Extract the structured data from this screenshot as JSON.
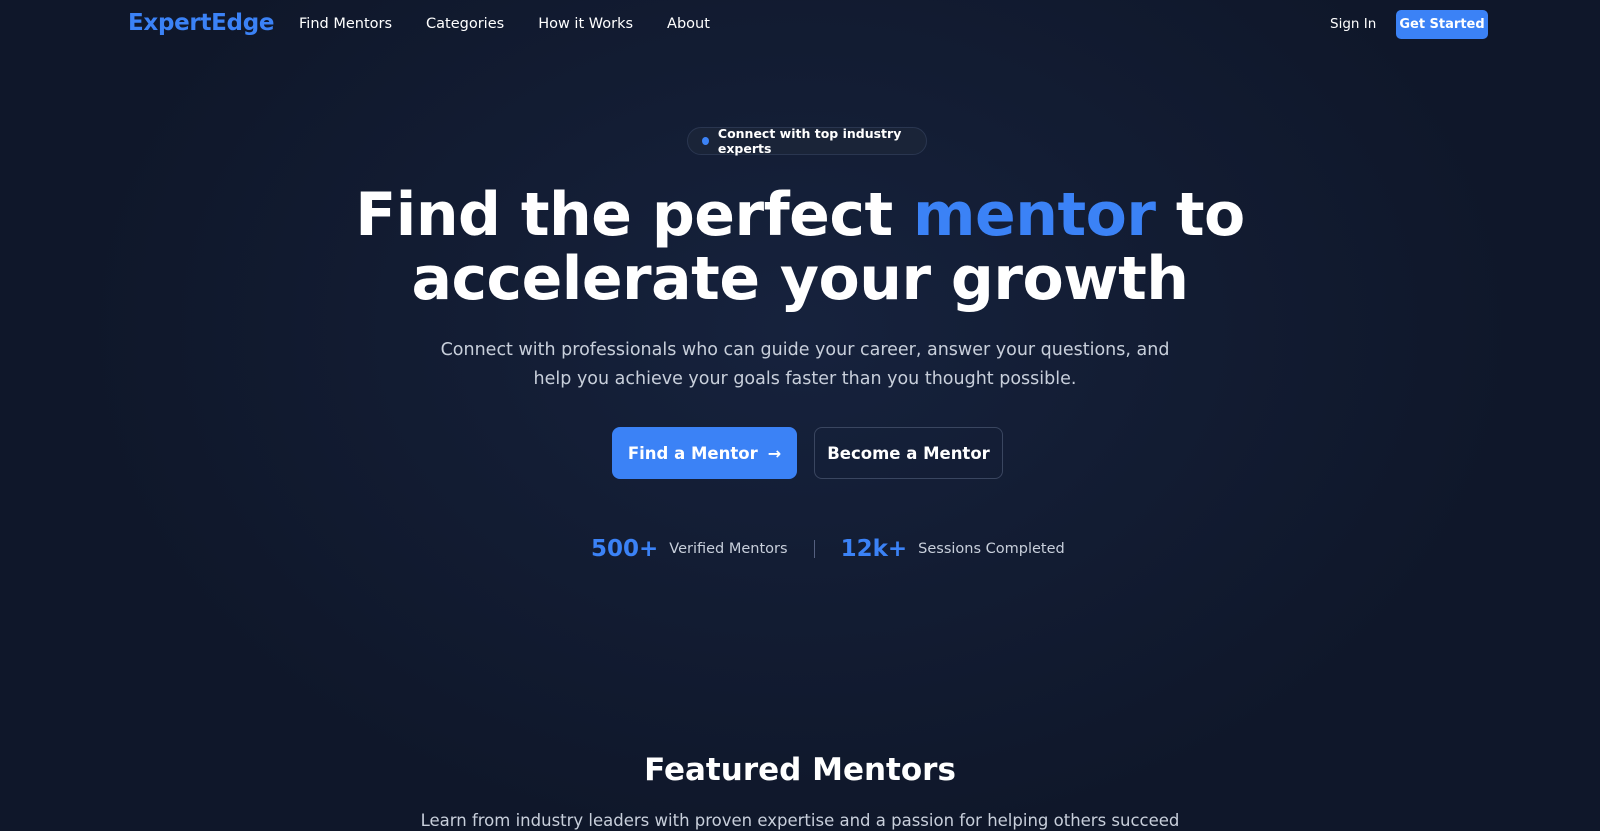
{
  "header": {
    "logo": "ExpertEdge",
    "nav": [
      "Find Mentors",
      "Categories",
      "How it Works",
      "About"
    ],
    "sign_in": "Sign In",
    "get_started": "Get Started"
  },
  "hero": {
    "badge": "Connect with top industry experts",
    "headline_part1": "Find the perfect ",
    "headline_accent": "mentor",
    "headline_part2": " to",
    "headline_line2": "accelerate your growth",
    "subtitle": "Connect with professionals who can guide your career, answer your questions, and help you achieve your goals faster than you thought possible.",
    "primary_button": "Find a Mentor",
    "secondary_button": "Become a Mentor",
    "stats": [
      {
        "value": "500+",
        "label": "Verified Mentors"
      },
      {
        "value": "12k+",
        "label": "Sessions Completed"
      }
    ]
  },
  "featured": {
    "title": "Featured Mentors",
    "subtitle": "Learn from industry leaders with proven expertise and a passion for helping others succeed"
  },
  "colors": {
    "background": "#0f172a",
    "accent": "#3b82f6",
    "muted_text": "#c8cfdb"
  },
  "icons": {
    "arrow": "arrow-right-icon",
    "badge_dot": "dot-icon"
  }
}
